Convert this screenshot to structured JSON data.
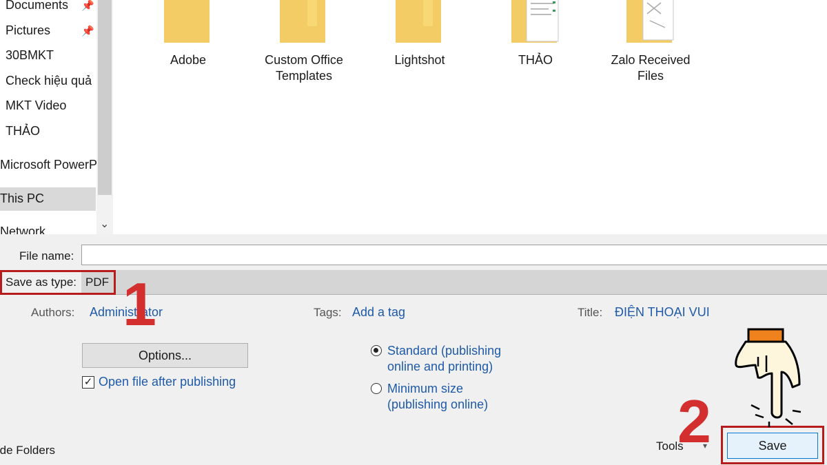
{
  "nav": {
    "items": [
      {
        "label": "Documents",
        "pinned": true
      },
      {
        "label": "Pictures",
        "pinned": true
      },
      {
        "label": "30BMKT",
        "pinned": false
      },
      {
        "label": "Check hiệu quả",
        "pinned": false
      },
      {
        "label": "MKT Video",
        "pinned": false
      },
      {
        "label": "THẢO",
        "pinned": false
      },
      {
        "label": "Microsoft PowerP",
        "pinned": false
      },
      {
        "label": "This PC",
        "pinned": false,
        "selected": true
      },
      {
        "label": "Network",
        "pinned": false
      }
    ]
  },
  "folders": [
    {
      "line1": "Adobe",
      "line2": ""
    },
    {
      "line1": "Custom Office",
      "line2": "Templates"
    },
    {
      "line1": "Lightshot",
      "line2": ""
    },
    {
      "line1": "THẢO",
      "line2": ""
    },
    {
      "line1": "Zalo Received",
      "line2": "Files"
    }
  ],
  "form": {
    "file_name_label": "File name:",
    "file_name_value": "",
    "save_type_label": "Save as type:",
    "save_type_value": "PDF"
  },
  "meta": {
    "authors_label": "Authors:",
    "authors_value": "Administrator",
    "tags_label": "Tags:",
    "tags_value": "Add a tag",
    "title_label": "Title:",
    "title_value": "ĐIỆN THOẠI VUI"
  },
  "options_button": "Options...",
  "open_after_label": "Open file after publishing",
  "open_after_checked": true,
  "optimize": {
    "standard_line1": "Standard (publishing",
    "standard_line2": "online and printing)",
    "minimum_line1": "Minimum size",
    "minimum_line2": "(publishing online)",
    "selected": "standard"
  },
  "footer": {
    "hide_folders": "Hide Folders",
    "tools": "Tools",
    "save": "Save"
  },
  "annotations": {
    "step1": "1",
    "step2": "2",
    "highlight_color": "#d32f2f"
  },
  "colors": {
    "folder": "#f8d775",
    "link": "#1e5aa8"
  }
}
